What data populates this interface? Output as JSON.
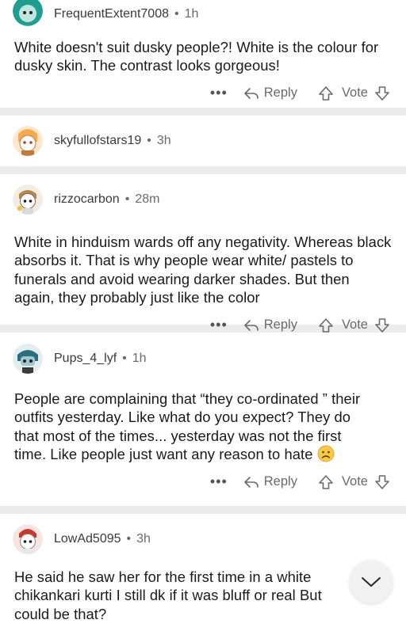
{
  "icons": {
    "more": "more-options-icon",
    "reply": "reply-arrow-icon",
    "upvote": "upvote-arrow-icon",
    "downvote": "downvote-arrow-icon",
    "fab": "chevron-down-icon",
    "frown": "frowning-face-emoji"
  },
  "action_labels": {
    "more": "•••",
    "reply": "Reply",
    "vote": "Vote"
  },
  "comments": [
    {
      "username": "FrequentExtent7008",
      "time": "1h",
      "body": "White doesn't suit dusky people?! White is the colour for dusky skin. The contrast looks gorgeous!"
    },
    {
      "username": "skyfullofstars19",
      "time": "3h"
    },
    {
      "username": "rizzocarbon",
      "time": "28m",
      "body": "White in hinduism wards off any negativity. Whereas black absorbs it. That is why people wear white/ pastels to funerals and avoid wearing darker shades. But then again, they probably just like the color"
    },
    {
      "username": "Pups_4_lyf",
      "time": "1h",
      "body": "People are complaining that “they co-ordinated ” their outfits yesterday. Like what do you expect? They do that most of the times... yesterday was not the first time. Like people just want any reason to hate"
    },
    {
      "username": "LowAd5095",
      "time": "3h",
      "body": "He said he saw her for the first time in a white chikankari kurti I still dk if it was bluff or real But could be that?"
    }
  ],
  "colors": {
    "separator": "#ececec",
    "meta_text": "#6a6a6a",
    "avatar_1": "#1f9e8f",
    "avatar_2": "#f5a94d",
    "avatar_3": "#b5874d",
    "avatar_4": "#2a6f7c",
    "avatar_5": "#c73a2a"
  }
}
